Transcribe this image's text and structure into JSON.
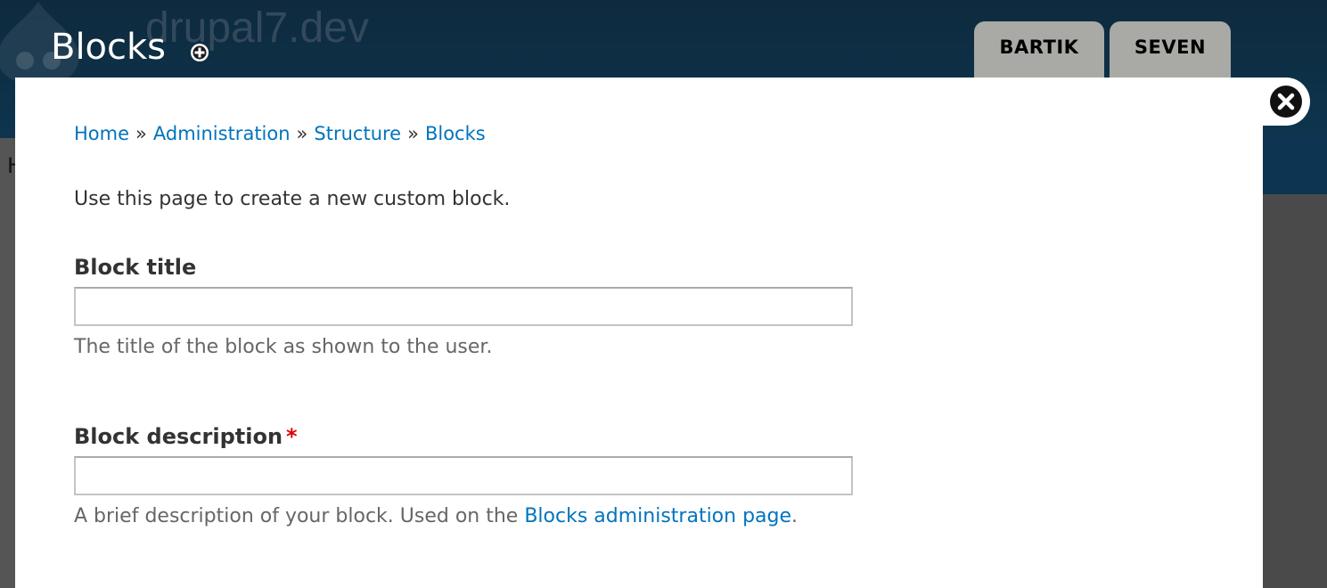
{
  "background": {
    "site_name": "drupal7.dev",
    "page_title": "Blocks",
    "shortcut_icon": "plus-circle-icon",
    "theme_tabs": [
      {
        "label": "BARTIK"
      },
      {
        "label": "SEVEN"
      }
    ],
    "left_edge_letter": "H"
  },
  "dialog": {
    "close_icon": "close-circle-icon",
    "breadcrumb": [
      {
        "label": "Home"
      },
      {
        "label": "Administration"
      },
      {
        "label": "Structure"
      },
      {
        "label": "Blocks"
      }
    ],
    "breadcrumb_separator": "»",
    "intro_text": "Use this page to create a new custom block.",
    "fields": {
      "block_title": {
        "label": "Block title",
        "value": "",
        "help": "The title of the block as shown to the user."
      },
      "block_description": {
        "label": "Block description",
        "required_marker": "*",
        "value": "",
        "help_prefix": "A brief description of your block. Used on the ",
        "help_link": "Blocks administration page",
        "help_suffix": "."
      }
    }
  },
  "colors": {
    "link": "#0074bd",
    "required": "#e00000",
    "header_bg": "#0d3450",
    "tab_bg": "#a9a9a5"
  }
}
